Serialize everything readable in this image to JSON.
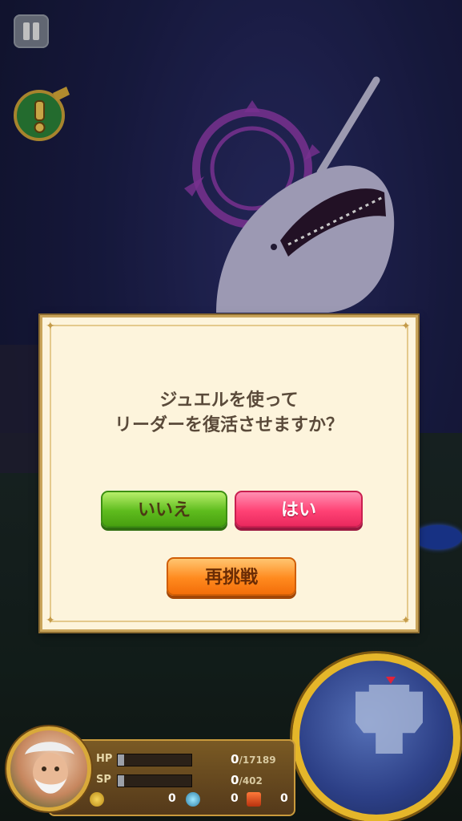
{
  "dialog": {
    "message_line1": "ジュエルを使って",
    "message_line2": "リーダーを復活させますか？",
    "no_label": "いいえ",
    "yes_label": "はい",
    "retry_label": "再挑戦"
  },
  "status": {
    "hp_label": "HP",
    "hp_current": "0",
    "hp_max": "/17189",
    "sp_label": "SP",
    "sp_current": "0",
    "sp_max": "/402"
  },
  "inventory": {
    "coin_count": "0",
    "potion_count": "0",
    "chest_count": "0"
  },
  "icons": {
    "pause": "pause-icon",
    "alert": "exclamation-icon",
    "coin": "coin-icon",
    "potion": "potion-icon",
    "chest": "treasure-chest-icon"
  },
  "colors": {
    "dialog_bg": "#fdf4dc",
    "no_button": "#5fbc1e",
    "yes_button": "#ff4275",
    "retry_button": "#ff8a1e",
    "minimap_ring": "#e5b62a"
  }
}
